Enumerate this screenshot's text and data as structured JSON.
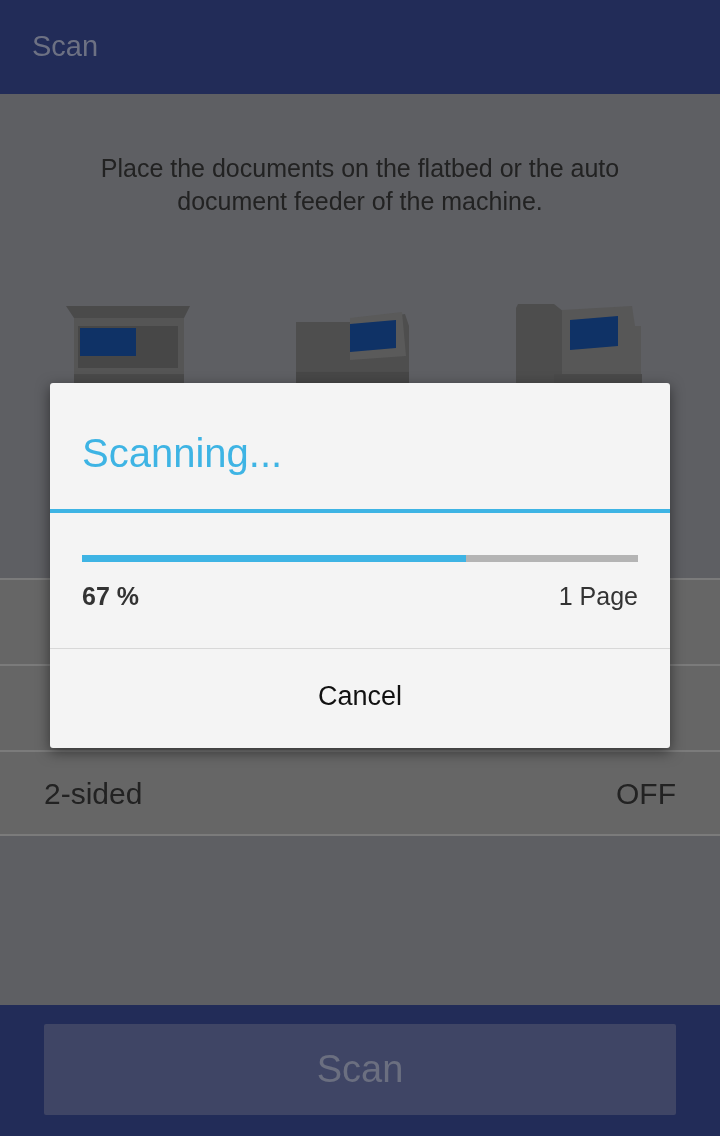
{
  "app_bar": {
    "title": "Scan"
  },
  "instruction": "Place the documents on the flatbed or the auto document feeder of the machine.",
  "settings": [
    {
      "label": "2-sided",
      "value": "OFF"
    }
  ],
  "scan_button": {
    "label": "Scan",
    "disabled": true
  },
  "dialog": {
    "title": "Scanning...",
    "progress": {
      "level": 0.69
    },
    "percent": "67 %",
    "pages": "1 Page",
    "cancel": "Cancel"
  }
}
